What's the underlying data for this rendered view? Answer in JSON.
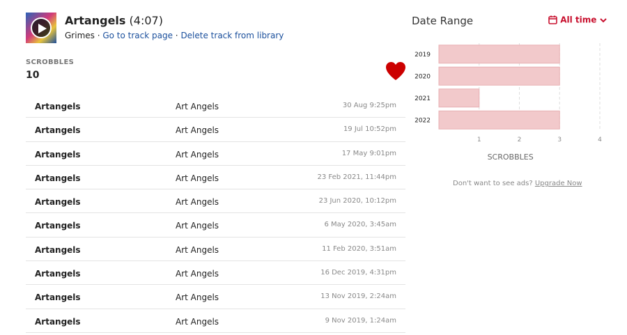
{
  "track": {
    "title": "Artangels",
    "duration": "(4:07)",
    "artist": "Grimes",
    "separator": " · ",
    "go_to_track": "Go to track page",
    "delete_track": "Delete track from library"
  },
  "stats": {
    "scrobbles_label": "SCROBBLES",
    "scrobbles_count": "10",
    "loved": true,
    "heart_color": "#c00"
  },
  "scrobble_rows": [
    {
      "track": "Artangels",
      "album": "Art Angels",
      "time": "30 Aug 9:25pm"
    },
    {
      "track": "Artangels",
      "album": "Art Angels",
      "time": "19 Jul 10:52pm"
    },
    {
      "track": "Artangels",
      "album": "Art Angels",
      "time": "17 May 9:01pm"
    },
    {
      "track": "Artangels",
      "album": "Art Angels",
      "time": "23 Feb 2021, 11:44pm"
    },
    {
      "track": "Artangels",
      "album": "Art Angels",
      "time": "23 Jun 2020, 10:12pm"
    },
    {
      "track": "Artangels",
      "album": "Art Angels",
      "time": "6 May 2020, 3:45am"
    },
    {
      "track": "Artangels",
      "album": "Art Angels",
      "time": "11 Feb 2020, 3:51am"
    },
    {
      "track": "Artangels",
      "album": "Art Angels",
      "time": "16 Dec 2019, 4:31pm"
    },
    {
      "track": "Artangels",
      "album": "Art Angels",
      "time": "13 Nov 2019, 2:24am"
    },
    {
      "track": "Artangels",
      "album": "Art Angels",
      "time": "9 Nov 2019, 1:24am"
    }
  ],
  "date_range": {
    "title": "Date Range",
    "selected": "All time",
    "accent_color": "#c8102e"
  },
  "chart_data": {
    "type": "bar",
    "orientation": "horizontal",
    "categories": [
      "2019",
      "2020",
      "2021",
      "2022"
    ],
    "values": [
      3,
      3,
      1,
      3
    ],
    "xlabel": "SCROBBLES",
    "xlim": [
      0,
      4
    ],
    "xticks": [
      "1",
      "2",
      "3",
      "4"
    ],
    "grid": true,
    "bar_color": "#f2c9cb",
    "bar_border": "#e8b0b3"
  },
  "ad": {
    "text": "Don't want to see ads?",
    "link": "Upgrade Now"
  }
}
